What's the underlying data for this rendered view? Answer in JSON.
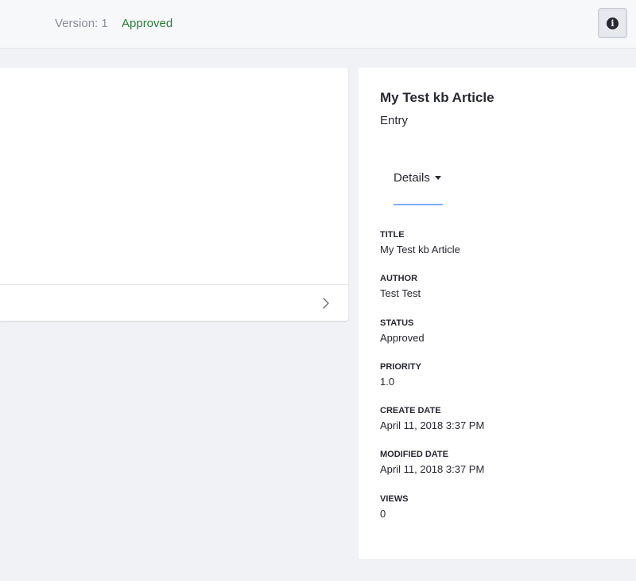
{
  "header": {
    "version_text": "Version: 1",
    "status_text": "Approved",
    "info_icon": "info-circle-icon",
    "info_glyph": "i"
  },
  "content_card": {
    "footer_icon": "chevron-right-icon"
  },
  "sidebar": {
    "title": "My Test kb Article",
    "subtitle": "Entry",
    "tab": {
      "label": "Details",
      "icon": "caret-down-icon"
    },
    "fields": [
      {
        "label": "TITLE",
        "value": "My Test kb Article"
      },
      {
        "label": "AUTHOR",
        "value": "Test Test"
      },
      {
        "label": "STATUS",
        "value": "Approved"
      },
      {
        "label": "PRIORITY",
        "value": "1.0"
      },
      {
        "label": "CREATE DATE",
        "value": "April 11, 2018 3:37 PM"
      },
      {
        "label": "MODIFIED DATE",
        "value": "April 11, 2018 3:37 PM"
      },
      {
        "label": "VIEWS",
        "value": "0"
      }
    ]
  },
  "colors": {
    "approved": "#287d3c",
    "tab_underline": "#80acff",
    "page_background": "#f1f2f5"
  }
}
